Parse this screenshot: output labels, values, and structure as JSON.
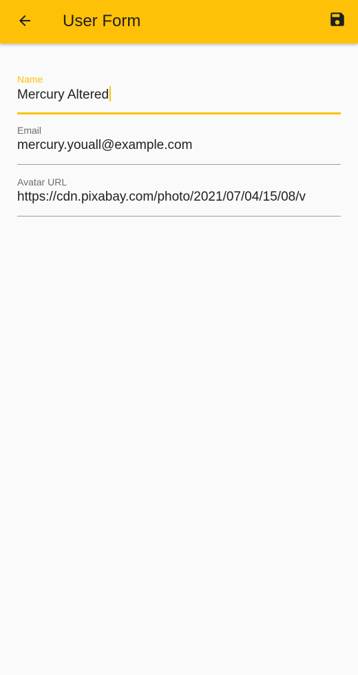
{
  "appbar": {
    "title": "User Form",
    "back_icon": "arrow-left-icon",
    "save_icon": "floppy-disk-icon",
    "color": "#ffc107"
  },
  "form": {
    "name": {
      "label": "Name",
      "value": "Mercury Altered"
    },
    "email": {
      "label": "Email",
      "value": "mercury.youall@example.com"
    },
    "avatar_url": {
      "label": "Avatar URL",
      "value": "https://cdn.pixabay.com/photo/2021/07/04/15/08/v"
    }
  },
  "colors": {
    "accent": "#ffc107",
    "background": "#fafafa",
    "underline": "#9e9e9e"
  }
}
